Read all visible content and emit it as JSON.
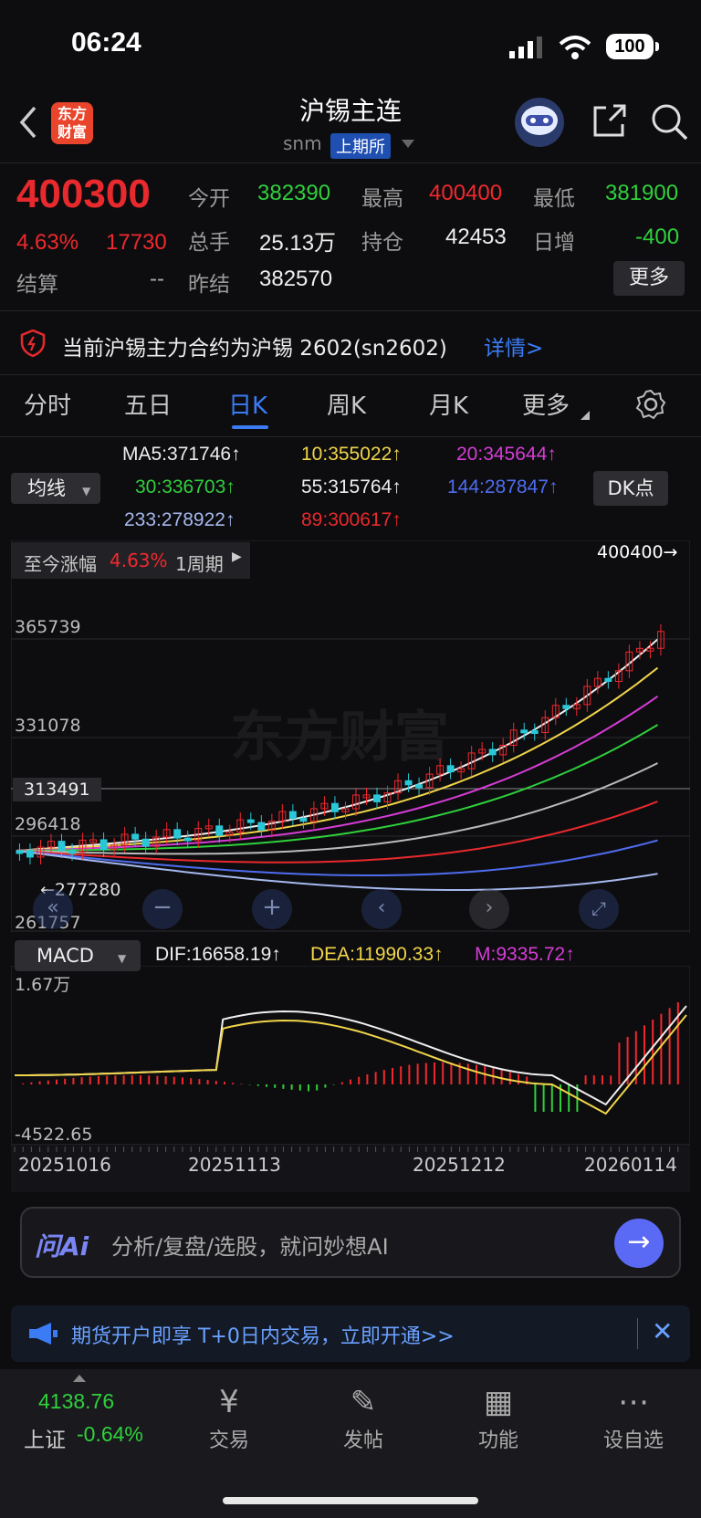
{
  "status": {
    "time": "06:24",
    "battery": "100"
  },
  "header": {
    "title": "沪锡主连",
    "symbol": "snm",
    "exchange": "上期所",
    "logo_text": "东方财富"
  },
  "quote": {
    "price": "400300",
    "change_pct": "4.63%",
    "change": "17730",
    "open_label": "今开",
    "open": "382390",
    "high_label": "最高",
    "high": "400400",
    "low_label": "最低",
    "low": "381900",
    "volume_label": "总手",
    "volume": "25.13万",
    "oi_label": "持仓",
    "oi": "42453",
    "daily_inc_label": "日增",
    "daily_inc": "-400",
    "settle_label": "结算",
    "settle": "--",
    "prev_settle_label": "昨结",
    "prev_settle": "382570",
    "more_label": "更多"
  },
  "notice": {
    "text": "当前沪锡主力合约为沪锡 2602(sn2602)",
    "link": "详情>"
  },
  "tabs": [
    "分时",
    "五日",
    "日K",
    "周K",
    "月K",
    "更多"
  ],
  "indicators": {
    "ma5": "MA5:371746↑",
    "ma10": "10:355022↑",
    "ma20": "20:345644↑",
    "ma30": "30:336703↑",
    "ma55": "55:315764↑",
    "ma144": "144:287847↑",
    "ma233": "233:278922↑",
    "ma89": "89:300617↑",
    "avg_label": "均线",
    "dk_label": "DK点"
  },
  "kline": {
    "gain_label": "至今涨幅",
    "gain_value": "4.63%",
    "period": "1周期",
    "max_marker": "400400→",
    "low_marker": "←277280",
    "levels": [
      "365739",
      "331078",
      "313491",
      "296418",
      "261757"
    ],
    "watermark": "东方财富"
  },
  "macd": {
    "label": "MACD",
    "dif": "DIF:16658.19↑",
    "dea": "DEA:11990.33↑",
    "m": "M:9335.72↑",
    "top": "1.67万",
    "bottom": "-4522.65",
    "dates": [
      "20251016",
      "20251113",
      "20251212",
      "20260114"
    ]
  },
  "ai": {
    "brand": "问Ai",
    "placeholder": "分析/复盘/选股，就问妙想AI"
  },
  "banner": {
    "text": "期货开户即享 T+0日内交易，立即开通>>"
  },
  "nav": {
    "index_value": "4138.76",
    "index_name": "上证",
    "index_change": "-0.64%",
    "items": [
      "交易",
      "发帖",
      "功能",
      "设自选"
    ]
  },
  "colors": {
    "up": "#f0282d",
    "down": "#2fd03c",
    "accent": "#3b7cf5"
  }
}
